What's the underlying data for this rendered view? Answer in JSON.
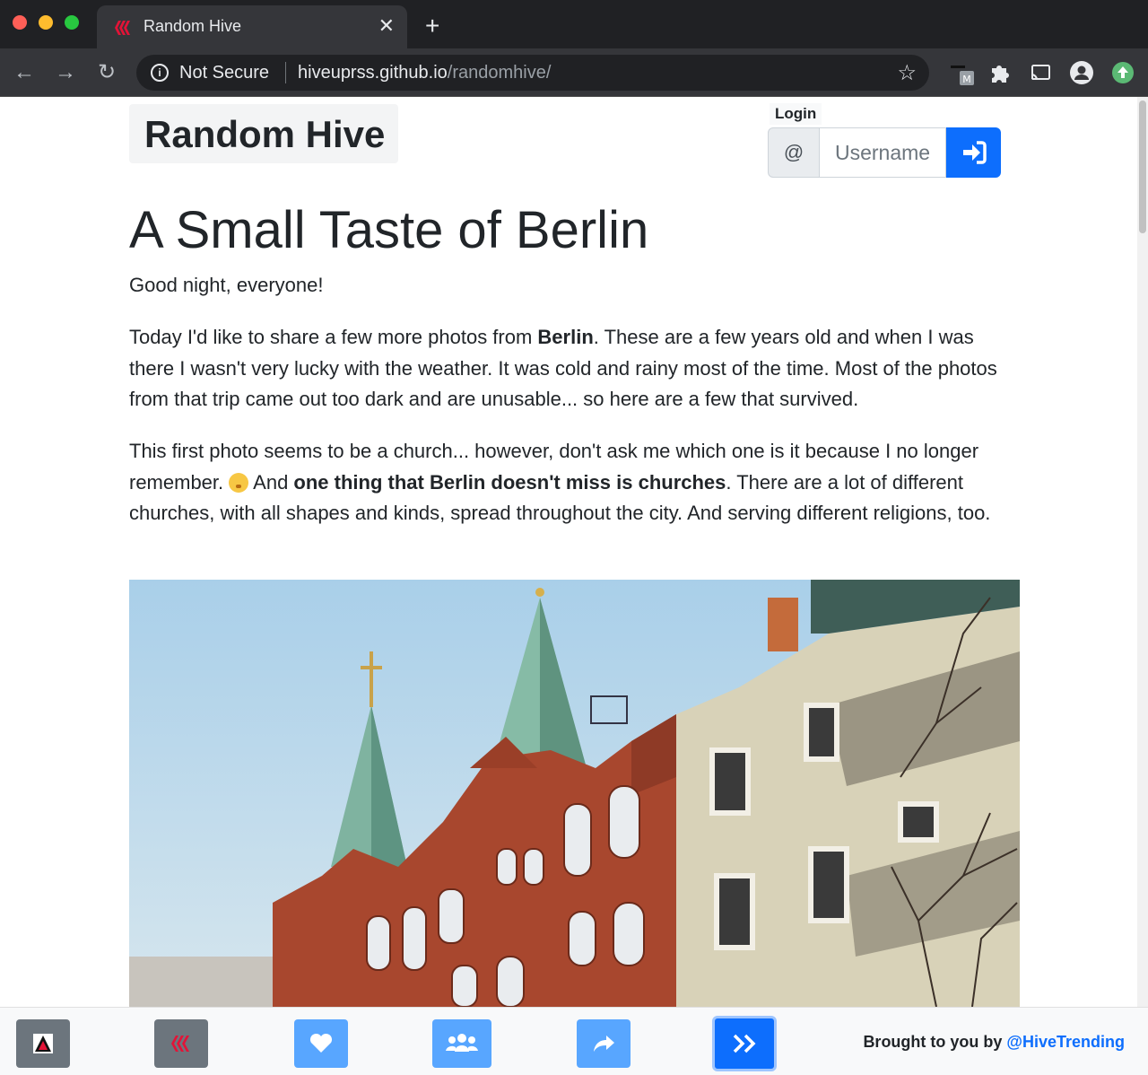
{
  "browser": {
    "tab_title": "Random Hive",
    "not_secure_label": "Not Secure",
    "url_host": "hiveuprss.github.io",
    "url_path": "/randomhive/"
  },
  "header": {
    "brand": "Random Hive",
    "login_label": "Login",
    "at_symbol": "@",
    "username_placeholder": "Username"
  },
  "post": {
    "title": "A Small Taste of Berlin",
    "p1": "Good night, everyone!",
    "p2_a": "Today I'd like to share a few more photos from ",
    "p2_bold": "Berlin",
    "p2_b": ". These are a few years old and when I was there I wasn't very lucky with the weather. It was cold and rainy most of the time. Most of the photos from that trip came out too dark and are unusable... so here are a few that survived.",
    "p3_a": "This first photo seems to be a church... however, don't ask me which one is it because I no longer remember. ",
    "p3_b": " And ",
    "p3_bold": "one thing that Berlin doesn't miss is churches",
    "p3_c": ". There are a lot of different churches, with all shapes and kinds, spread throughout the city. And serving different religions, too."
  },
  "footer": {
    "credit_prefix": "Brought to you by ",
    "credit_link": "@HiveTrending"
  },
  "icons": {
    "bottom_buttons": [
      "peakd-icon",
      "hive-icon",
      "heart-icon",
      "users-icon",
      "share-icon",
      "next-icon"
    ]
  },
  "colors": {
    "primary": "#0d6efd",
    "light_primary": "#58a6ff",
    "dark_button": "#6c757d"
  }
}
